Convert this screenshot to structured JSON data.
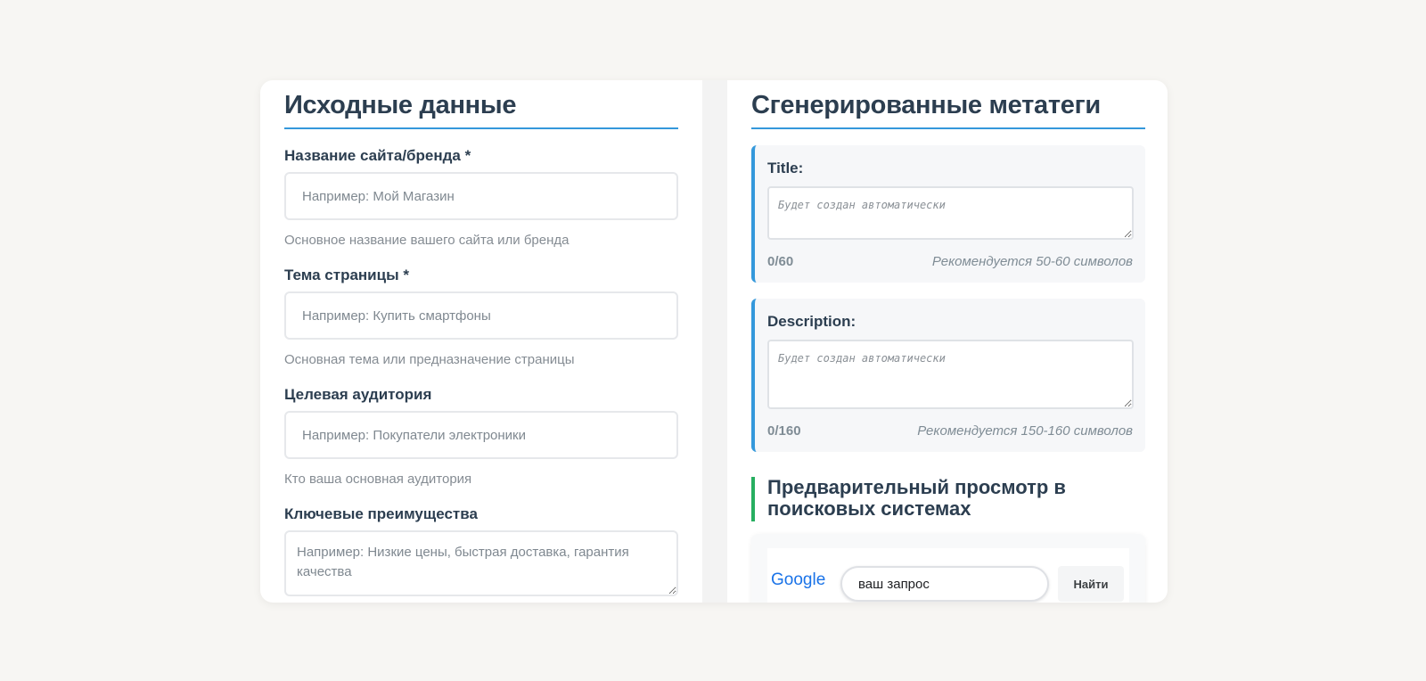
{
  "left": {
    "title": "Исходные данные",
    "fields": [
      {
        "label": "Название сайта/бренда *",
        "placeholder": "Например: Мой Магазин",
        "hint": "Основное название вашего сайта или бренда"
      },
      {
        "label": "Тема страницы *",
        "placeholder": "Например: Купить смартфоны",
        "hint": "Основная тема или предназначение страницы"
      },
      {
        "label": "Целевая аудитория",
        "placeholder": "Например: Покупатели электроники",
        "hint": "Кто ваша основная аудитория"
      },
      {
        "label": "Ключевые преимущества",
        "placeholder": "Например: Низкие цены, быстрая доставка, гарантия качества"
      }
    ]
  },
  "right": {
    "title": "Сгенерированные метатеги",
    "meta_title": {
      "label": "Title:",
      "placeholder": "Будет создан автоматически",
      "counter": "0/60",
      "recommendation": "Рекомендуется 50-60 символов"
    },
    "meta_description": {
      "label": "Description:",
      "placeholder": "Будет создан автоматически",
      "counter": "0/160",
      "recommendation": "Рекомендуется 150-160 символов"
    },
    "preview": {
      "title": "Предварительный просмотр в поисковых системах",
      "search_logo": "Google",
      "search_query": "ваш запрос",
      "search_button": "Найти"
    }
  },
  "colors": {
    "accent": "#3498db",
    "preview_accent": "#27ae60",
    "heading": "#2c3e50"
  }
}
